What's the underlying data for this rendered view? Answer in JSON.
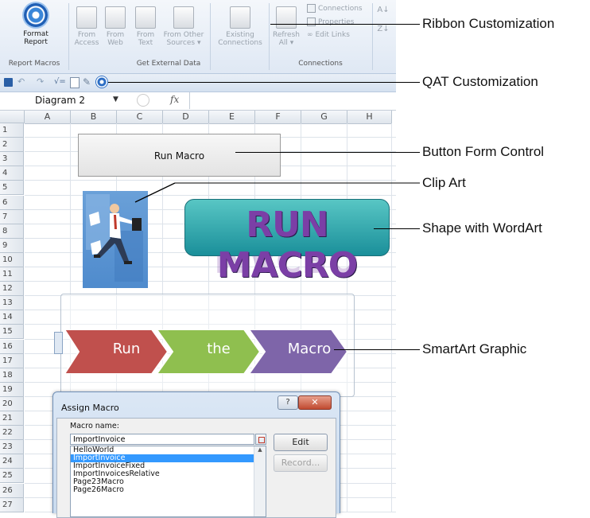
{
  "ribbon": {
    "format_report": [
      "Format",
      "Report"
    ],
    "from_access": [
      "From",
      "Access"
    ],
    "from_web": [
      "From",
      "Web"
    ],
    "from_text": [
      "From",
      "Text"
    ],
    "from_other": [
      "From Other",
      "Sources ▾"
    ],
    "existing": [
      "Existing",
      "Connections"
    ],
    "refresh": [
      "Refresh",
      "All ▾"
    ],
    "connections": "Connections",
    "properties": "Properties",
    "edit_links": "Edit Links",
    "groups": {
      "report_macros": "Report Macros",
      "get_external": "Get External Data",
      "connections": "Connections"
    }
  },
  "formula_bar": {
    "name_box": "Diagram 2",
    "fx": "fx"
  },
  "columns": [
    "A",
    "B",
    "C",
    "D",
    "E",
    "F",
    "G",
    "H"
  ],
  "rows": [
    "1",
    "2",
    "3",
    "4",
    "5",
    "6",
    "7",
    "8",
    "9",
    "10",
    "11",
    "12",
    "13",
    "14",
    "15",
    "16",
    "17",
    "18",
    "19",
    "20",
    "21",
    "22",
    "23",
    "24",
    "25",
    "26",
    "27"
  ],
  "sheet": {
    "run_macro_button": "Run Macro",
    "wordart": "RUN MACRO",
    "smartart": [
      "Run",
      "the",
      "Macro"
    ]
  },
  "dialog": {
    "title": "Assign Macro",
    "macro_name_label": "Macro name:",
    "macro_name_value": "ImportInvoice",
    "list": [
      "HelloWorld",
      "ImportInvoice",
      "ImportInvoiceFixed",
      "ImportInvoicesRelative",
      "Page23Macro",
      "Page26Macro"
    ],
    "selected": "ImportInvoice",
    "edit_button": "Edit",
    "record_button": "Record..."
  },
  "callouts": {
    "ribbon": "Ribbon Customization",
    "qat": "QAT Customization",
    "button": "Button Form Control",
    "clipart": "Clip Art",
    "wordart": "Shape with WordArt",
    "smartart": "SmartArt Graphic"
  },
  "colors": {
    "accent": "#2a6cc4",
    "smartart_red": "#c0504d",
    "smartart_green": "#8fbf4f",
    "smartart_purple": "#7e65a9",
    "wordart_fill": "#6a3fa0",
    "wordart_bg": "#2aa8b0"
  }
}
